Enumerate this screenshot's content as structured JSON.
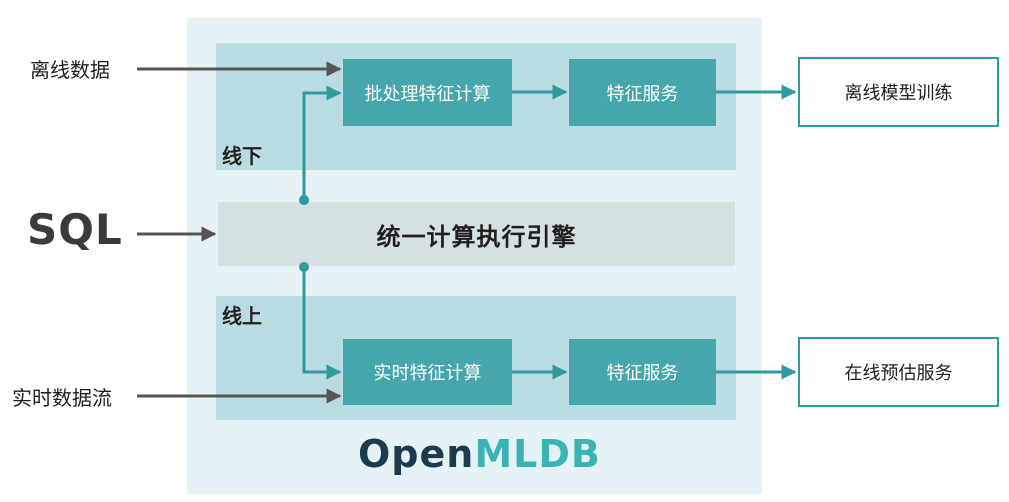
{
  "sources": {
    "offline_data": "离线数据",
    "sql": "SQL",
    "realtime_stream": "实时数据流"
  },
  "zones": {
    "offline_label": "线下",
    "online_label": "线上"
  },
  "engine": {
    "label": "统一计算执行引擎"
  },
  "offline": {
    "batch_compute": "批处理特征计算",
    "feature_service": "特征服务",
    "output": "离线模型训练"
  },
  "online": {
    "realtime_compute": "实时特征计算",
    "feature_service": "特征服务",
    "output": "在线预估服务"
  },
  "logo": {
    "part1": "Open",
    "part2": "MLDB",
    "color_dark": "#1d3b4f",
    "color_accent": "#3bb3b5"
  },
  "colors": {
    "teal_box": "#45a6ac",
    "zone_fill": "#b9dde2",
    "frame_fill": "#e6f3f6",
    "engine_fill": "#d4e0e2",
    "arrow_gray": "#555555",
    "arrow_teal": "#2f9aa0"
  }
}
